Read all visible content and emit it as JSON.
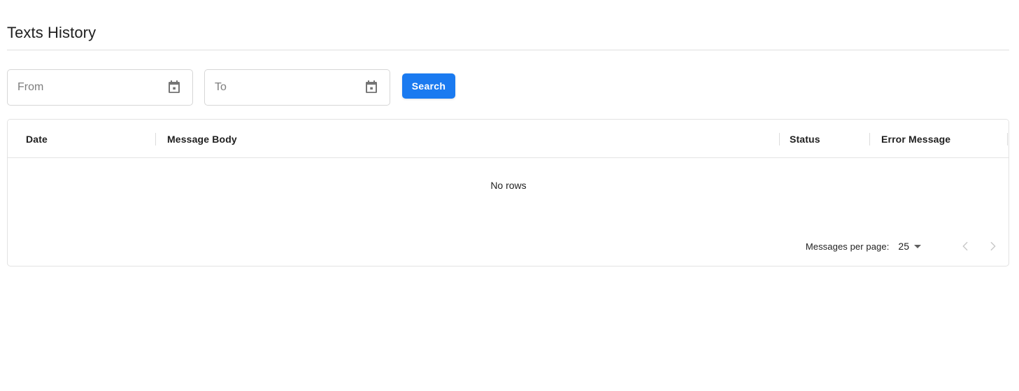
{
  "page": {
    "title": "Texts History"
  },
  "filters": {
    "from": {
      "placeholder": "From",
      "value": "",
      "icon": "calendar-icon"
    },
    "to": {
      "placeholder": "To",
      "value": "",
      "icon": "calendar-icon"
    },
    "search_label": "Search",
    "search_color": "#1a7af0"
  },
  "table": {
    "columns": [
      {
        "label": "Date"
      },
      {
        "label": "Message Body"
      },
      {
        "label": "Status"
      },
      {
        "label": "Error Message"
      }
    ],
    "rows": [],
    "empty_message": "No rows"
  },
  "pagination": {
    "rows_per_page_label": "Messages per page:",
    "rows_per_page_value": "25",
    "options": [
      "25"
    ],
    "prev_label": "chevron-left-icon",
    "next_label": "chevron-right-icon",
    "prev_enabled": false,
    "next_enabled": false
  }
}
